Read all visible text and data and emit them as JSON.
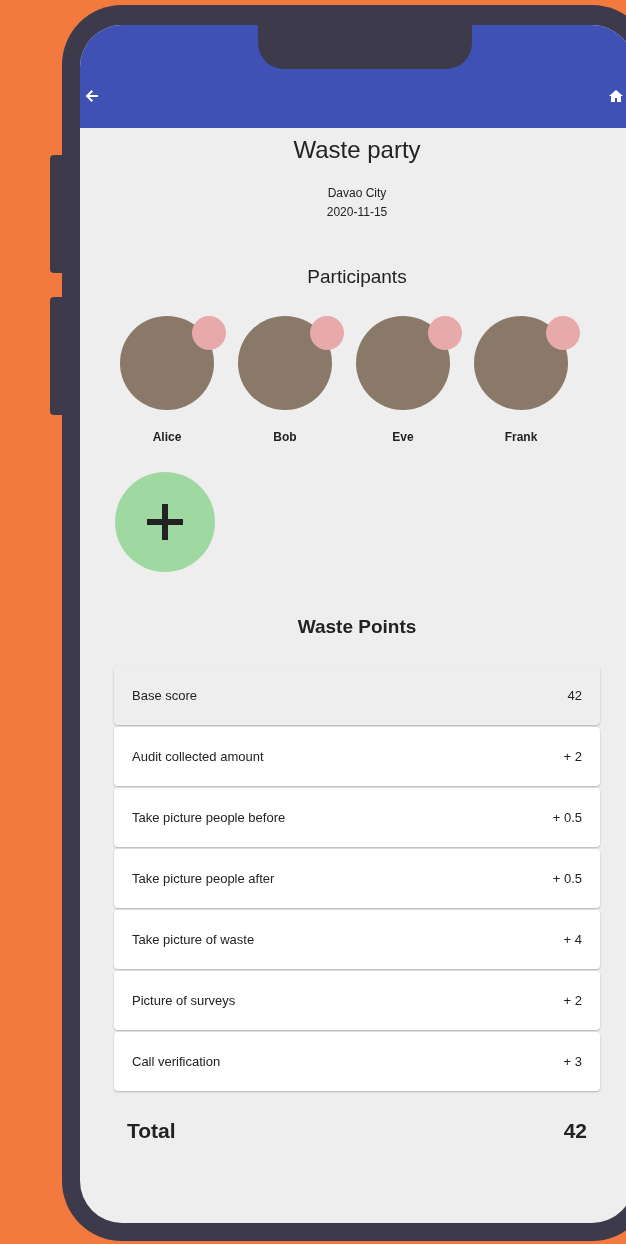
{
  "header": {
    "title": "Waste party",
    "location": "Davao City",
    "date": "2020-11-15"
  },
  "participants": {
    "heading": "Participants",
    "people": [
      {
        "name": "Alice"
      },
      {
        "name": "Bob"
      },
      {
        "name": "Eve"
      },
      {
        "name": "Frank"
      }
    ]
  },
  "points": {
    "heading": "Waste Points",
    "rows": [
      {
        "kind": "base",
        "label": "Base score",
        "value": "42"
      },
      {
        "kind": "bonus",
        "label": "Audit collected amount",
        "value": "+ 2"
      },
      {
        "kind": "bonus",
        "label": "Take picture people before",
        "value": "+ 0.5"
      },
      {
        "kind": "bonus",
        "label": "Take picture people after",
        "value": "+ 0.5"
      },
      {
        "kind": "bonus",
        "label": "Take picture of waste",
        "value": "+ 4"
      },
      {
        "kind": "bonus",
        "label": "Picture of surveys",
        "value": "+ 2"
      },
      {
        "kind": "bonus",
        "label": "Call verification",
        "value": "+ 3"
      }
    ]
  },
  "total": {
    "label": "Total",
    "value": "42"
  }
}
